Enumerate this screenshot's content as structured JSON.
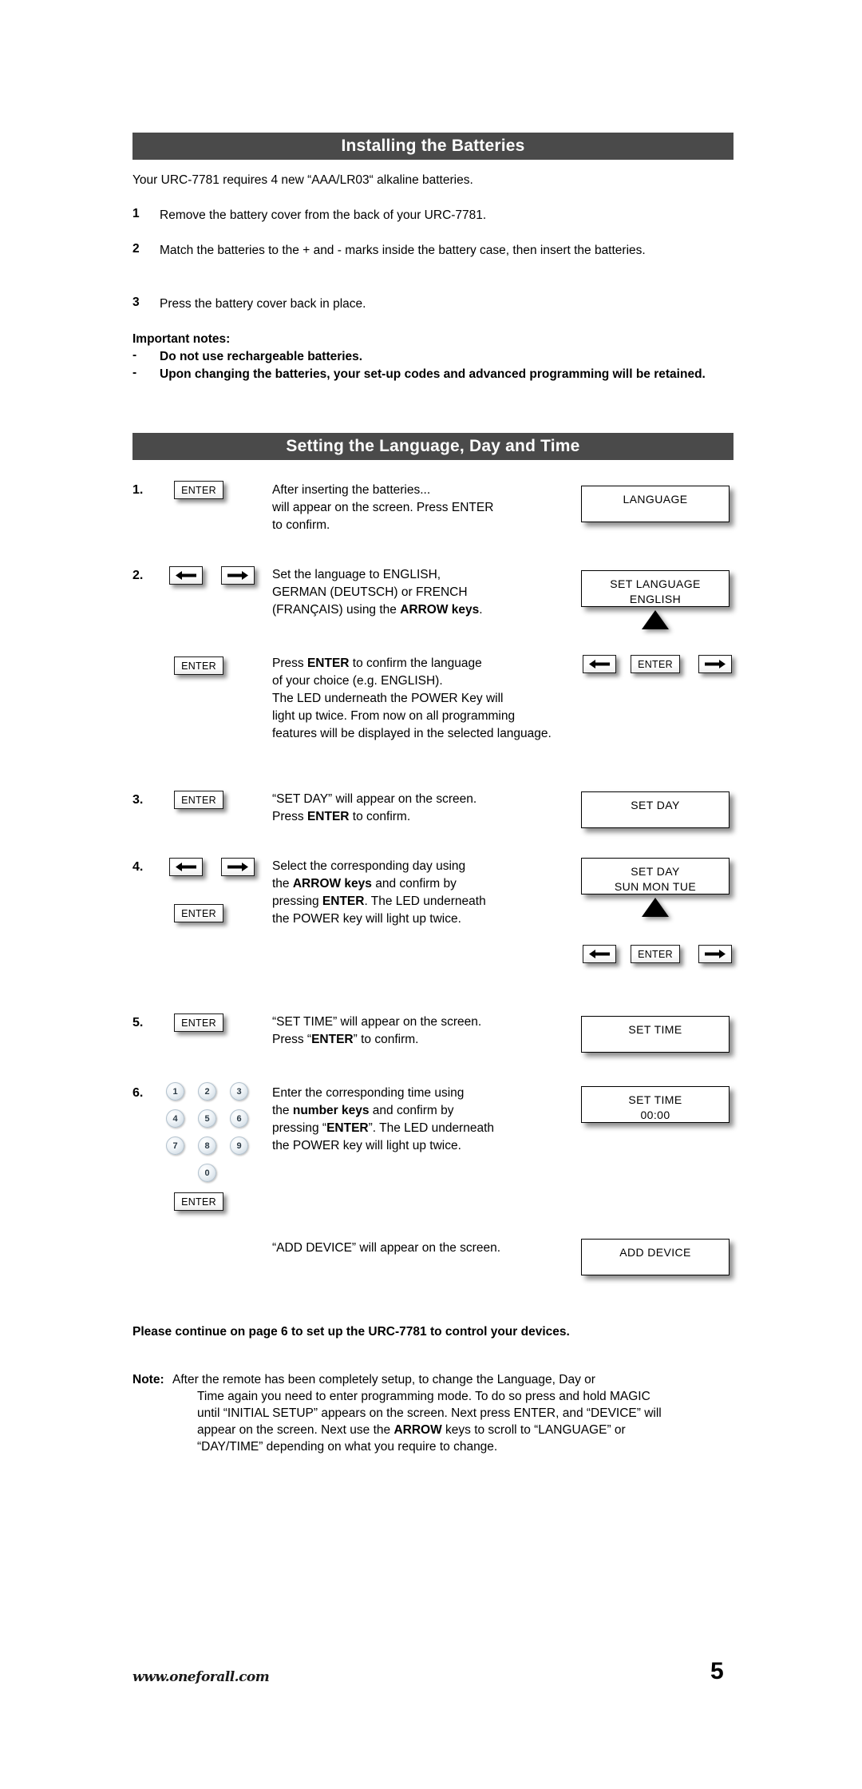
{
  "document": {
    "page_number": "5",
    "footer_url": "www.oneforall.com"
  },
  "section_batteries": {
    "title": "Installing the Batteries",
    "intro": "Your URC-7781 requires 4 new “AAA/LR03“ alkaline batteries.",
    "steps": [
      {
        "num": "1",
        "text": "Remove the battery cover from the back of your URC-7781."
      },
      {
        "num": "2",
        "text": "Match the batteries to the + and - marks inside the battery case, then insert the batteries."
      },
      {
        "num": "3",
        "text": "Press the battery cover back in place."
      }
    ],
    "notes_title": "Important notes:",
    "notes": [
      {
        "bullet": "-",
        "text": "Do not use rechargeable batteries."
      },
      {
        "bullet": "-",
        "text": "Upon changing the batteries, your set-up codes and advanced programming will be retained."
      }
    ]
  },
  "section_language": {
    "title": "Setting the Language, Day and Time",
    "steps": {
      "s1": {
        "num": "1.",
        "key_label": "ENTER",
        "line1": "After inserting the batteries...",
        "line2": "will appear on the screen. Press ENTER",
        "line3": "to confirm.",
        "lcd_line1": "LANGUAGE"
      },
      "s2": {
        "num": "2.",
        "line1": "Set the language to ENGLISH,",
        "line2": "GERMAN (DEUTSCH) or FRENCH",
        "line3_a": "(FRANÇAIS) using the ",
        "line3_b": "ARROW keys",
        "line3_c": ".",
        "lcd_line1": "SET LANGUAGE",
        "lcd_line2": "ENGLISH",
        "key_enter": "ENTER"
      },
      "s2b": {
        "key_label": "ENTER",
        "line1_a": "Press ",
        "line1_b": "ENTER",
        "line1_c": " to confirm the language",
        "line2": "of your choice (e.g. ENGLISH).",
        "line3": "The LED underneath the POWER Key will",
        "line4": "light up twice. From now on all programming",
        "line5": "features will be displayed in the selected language."
      },
      "s3": {
        "num": "3.",
        "key_label": "ENTER",
        "line1": "“SET DAY” will appear on the screen.",
        "line2_a": "Press ",
        "line2_b": "ENTER",
        "line2_c": " to confirm.",
        "lcd_line1": "SET DAY"
      },
      "s4": {
        "num": "4.",
        "key_label": "ENTER",
        "line1": "Select the corresponding day using",
        "line2_a": "the ",
        "line2_b": "ARROW keys",
        "line2_c": " and confirm by",
        "line3_a": "pressing ",
        "line3_b": "ENTER",
        "line3_c": ". The LED underneath",
        "line4": "the POWER key will light up twice.",
        "lcd_line1": "SET DAY",
        "lcd_line2": "SUN   MON   TUE",
        "key_enter": "ENTER"
      },
      "s5": {
        "num": "5.",
        "key_label": "ENTER",
        "line1": "“SET TIME” will appear on the screen.",
        "line2_a": "Press “",
        "line2_b": "ENTER",
        "line2_c": "” to confirm.",
        "lcd_line1": "SET TIME"
      },
      "s6": {
        "num": "6.",
        "key_label": "ENTER",
        "line1": "Enter the corresponding time using",
        "line2_a": "the ",
        "line2_b": "number keys",
        "line2_c": " and confirm  by",
        "line3_a": "pressing “",
        "line3_b": "ENTER",
        "line3_c": "”. The LED underneath",
        "line4": "the POWER key will light up twice.",
        "lcd_line1": "SET TIME",
        "lcd_line2": "00:00",
        "numpad": [
          "1",
          "2",
          "3",
          "4",
          "5",
          "6",
          "7",
          "8",
          "9",
          "0"
        ]
      },
      "s7": {
        "line1": "“ADD DEVICE” will appear on the screen.",
        "lcd_line1": "ADD DEVICE"
      }
    }
  },
  "footer_note": {
    "continue_line": "Please continue on page 6 to set up the URC-7781 to control your devices.",
    "note_label": "Note:",
    "note_line1": "After the remote has been completely setup, to change the Language, Day or",
    "note_line2": "Time again you need to enter programming mode. To do so press and hold MAGIC",
    "note_line3": "until “INITIAL SETUP” appears on the screen. Next press ENTER, and “DEVICE” will",
    "note_line4_a": "appear on the screen. Next use the ",
    "note_line4_b": "ARROW",
    "note_line4_c": " keys to scroll to “LANGUAGE” or",
    "note_line5": "“DAY/TIME” depending on what you require to change."
  },
  "colors": {
    "header_bar": "#4a4a4a",
    "header_text": "#ffffff",
    "body_text": "#000000"
  }
}
